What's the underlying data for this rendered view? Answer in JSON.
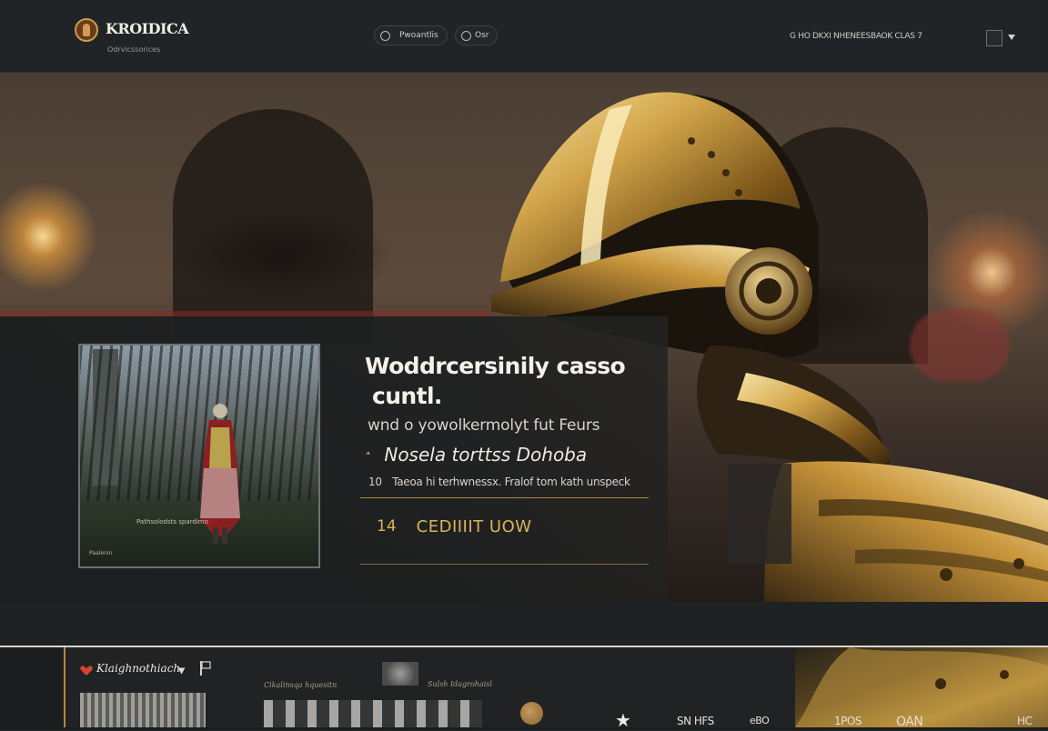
{
  "header": {
    "brand": "KROIDICA",
    "brand_sub": "Odrvicssorices",
    "nav_pill_1": "Pwoantlis",
    "nav_pill_2": "Osr",
    "right_text": "G HO DKXI NHENEESBAOK CLAS 7",
    "icons": [
      "logo-badge-icon",
      "circle-icon",
      "square-icon",
      "caret-down-icon"
    ]
  },
  "hero": {
    "title_line1": "Woddrcersinily casso",
    "title_line2": "cuntl.",
    "subtitle1": "wnd  o yowolkermolyt fut Feurs",
    "subtitle2_prefix": "˄",
    "subtitle2": "Nosela torttss Dohoba",
    "note_prefix": "10",
    "note": "Taeoa hi terhwnessx. Fralof tom kath unspeck",
    "cta_num": "14",
    "cta_label": "CEDIIIIT UOW",
    "photo_caption": "Pathsolodsts spardimo",
    "photo_corner": "Paalenin",
    "colors": {
      "gold": "#d9b45a",
      "panel": "#1e2021",
      "accent_rule": "#a88840"
    }
  },
  "bottom": {
    "label": "Klaighnothiach",
    "small_label_1": "Cikalinsqa hquesitn",
    "small_label_2": "Sulsh Idagrohaisl",
    "stat_1": "SN HFS",
    "stat_2": "eBO",
    "stat_3": "1POS",
    "stat_4": "OAN",
    "stat_5": "HC"
  }
}
